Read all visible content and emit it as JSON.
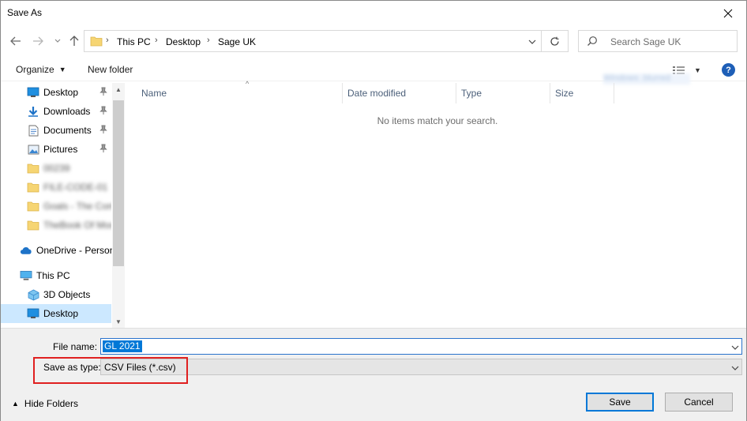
{
  "window": {
    "title": "Save As"
  },
  "address": {
    "breadcrumbs": [
      "This PC",
      "Desktop",
      "Sage UK"
    ]
  },
  "search": {
    "placeholder": "Search Sage UK"
  },
  "toolbar": {
    "organize_label": "Organize",
    "new_folder_label": "New folder",
    "help_label": "?"
  },
  "navigation": {
    "quick_access": [
      {
        "label": "Desktop",
        "icon": "desktop-icon",
        "pinned": true
      },
      {
        "label": "Downloads",
        "icon": "download-icon",
        "pinned": true
      },
      {
        "label": "Documents",
        "icon": "documents-icon",
        "pinned": true
      },
      {
        "label": "Pictures",
        "icon": "pictures-icon",
        "pinned": true
      },
      {
        "label": "00239",
        "icon": "folder-icon",
        "blurred": true
      },
      {
        "label": "FILE-CODE-01",
        "icon": "folder-icon",
        "blurred": true
      },
      {
        "label": "Goals - The Com",
        "icon": "folder-icon",
        "blurred": true
      },
      {
        "label": "TheBook Of Moo",
        "icon": "folder-icon",
        "blurred": true
      }
    ],
    "onedrive": {
      "label": "OneDrive - Person",
      "icon": "cloud-icon"
    },
    "this_pc": {
      "label": "This PC",
      "icon": "computer-icon"
    },
    "this_pc_items": [
      {
        "label": "3D Objects",
        "icon": "cube-icon"
      },
      {
        "label": "Desktop",
        "icon": "desktop-icon",
        "selected": true
      }
    ]
  },
  "file_list": {
    "columns": [
      "Name",
      "Date modified",
      "Type",
      "Size"
    ],
    "empty_message": "No items match your search.",
    "ghost_text": "Windows .blurred"
  },
  "form": {
    "file_name_label": "File name:",
    "file_name_value": "GL 2021",
    "save_type_label": "Save as type:",
    "save_type_value": "CSV Files (*.csv)"
  },
  "footer": {
    "hide_folders_label": "Hide Folders",
    "save_label": "Save",
    "cancel_label": "Cancel"
  },
  "colors": {
    "accent": "#0078d7",
    "highlight_box": "#e02020",
    "selected_nav": "#cce8ff",
    "form_background": "#f0f0f0"
  }
}
